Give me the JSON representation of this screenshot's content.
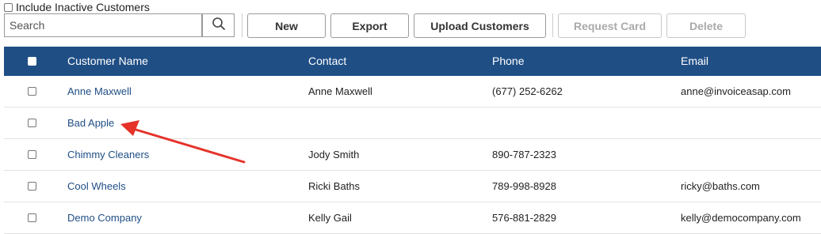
{
  "filters": {
    "include_inactive_label": "Include Inactive Customers"
  },
  "search": {
    "placeholder": "Search",
    "value": ""
  },
  "icons": {
    "search": "search-icon",
    "arrow": "red-arrow-annotation"
  },
  "toolbar": {
    "new_label": "New",
    "export_label": "Export",
    "upload_label": "Upload Customers",
    "request_card_label": "Request Card",
    "delete_label": "Delete"
  },
  "colors": {
    "header_bg": "#1f4e85",
    "link": "#1f4e85",
    "annotation_arrow": "#e5332a"
  },
  "table": {
    "columns": [
      "Customer Name",
      "Contact",
      "Phone",
      "Email"
    ],
    "rows": [
      {
        "name": "Anne Maxwell",
        "contact": "Anne Maxwell",
        "phone": "(677) 252-6262",
        "email": "anne@invoiceasap.com"
      },
      {
        "name": "Bad Apple",
        "contact": "",
        "phone": "",
        "email": ""
      },
      {
        "name": "Chimmy Cleaners",
        "contact": "Jody Smith",
        "phone": "890-787-2323",
        "email": ""
      },
      {
        "name": "Cool Wheels",
        "contact": "Ricki Baths",
        "phone": "789-998-8928",
        "email": "ricky@baths.com"
      },
      {
        "name": "Demo Company",
        "contact": "Kelly Gail",
        "phone": "576-881-2829",
        "email": "kelly@democompany.com"
      }
    ]
  }
}
